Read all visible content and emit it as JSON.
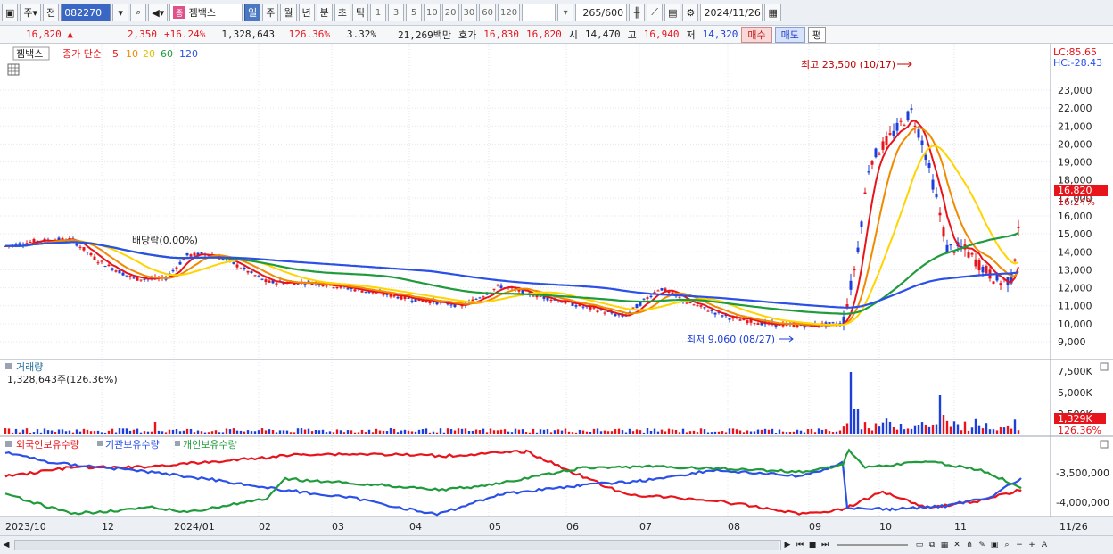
{
  "toolbar": {
    "period": "주",
    "prev": "전",
    "stock_code": "082270",
    "stock_name": "젬백스",
    "name_badge": "종",
    "intervals": [
      "일",
      "주",
      "월",
      "년",
      "분",
      "초",
      "틱"
    ],
    "active_interval": "일",
    "minute_steps": [
      "1",
      "3",
      "5",
      "10",
      "20",
      "30",
      "60",
      "120"
    ],
    "count": "265",
    "count_max": "/600",
    "date": "2024/11/26"
  },
  "quote": {
    "price": "16,820",
    "arrow": "▲",
    "change": "2,350",
    "change_pct": "+16.24%",
    "volume": "1,328,643",
    "vol_ratio": "126.36%",
    "turnover": "3.32%",
    "amount": "21,269백만",
    "ask_label": "호가",
    "ask": "16,830",
    "bid": "16,820",
    "open_label": "시",
    "open": "14,470",
    "high_label": "고",
    "high": "16,940",
    "low_label": "저",
    "low": "14,320",
    "buy": "매수",
    "sell": "매도",
    "eval": "평"
  },
  "price_panel": {
    "stock": "젬백스",
    "ma_title": "종가 단순",
    "ma_labels": [
      "5",
      "10",
      "20",
      "60",
      "120"
    ],
    "ma_colors": [
      "#e8141b",
      "#f08a00",
      "#ffd400",
      "#1f9b3c",
      "#2b50e8"
    ],
    "lc": "LC:85.65",
    "hc": "HC:-28.43",
    "high_annot": "최고 23,500 (10/17)",
    "low_annot": "최저 9,060 (08/27)",
    "dividend_annot": "배당락(0.00%)",
    "last_price": "16,820",
    "last_pct": "16.24%",
    "y_ticks": [
      "23,000",
      "22,000",
      "21,000",
      "20,000",
      "19,000",
      "18,000",
      "17,000",
      "16,000",
      "15,000",
      "14,000",
      "13,000",
      "12,000",
      "11,000",
      "10,000",
      "9,000"
    ]
  },
  "volume_panel": {
    "title": "거래량",
    "value": "1,328,643주(126.36%)",
    "y_ticks": [
      "7,500K",
      "5,000K",
      "2,500K"
    ],
    "last_vol": "1,329K",
    "last_pct": "126.36%"
  },
  "holding_panel": {
    "labels": [
      "외국인보유수량",
      "기관보유수량",
      "개인보유수량"
    ],
    "y_ticks": [
      "-3,500,000",
      "-4,000,000"
    ]
  },
  "x_axis": {
    "labels": [
      "2023/10",
      "12",
      "2024/01",
      "02",
      "03",
      "04",
      "05",
      "06",
      "07",
      "08",
      "09",
      "10",
      "11",
      "11/26"
    ]
  }
}
